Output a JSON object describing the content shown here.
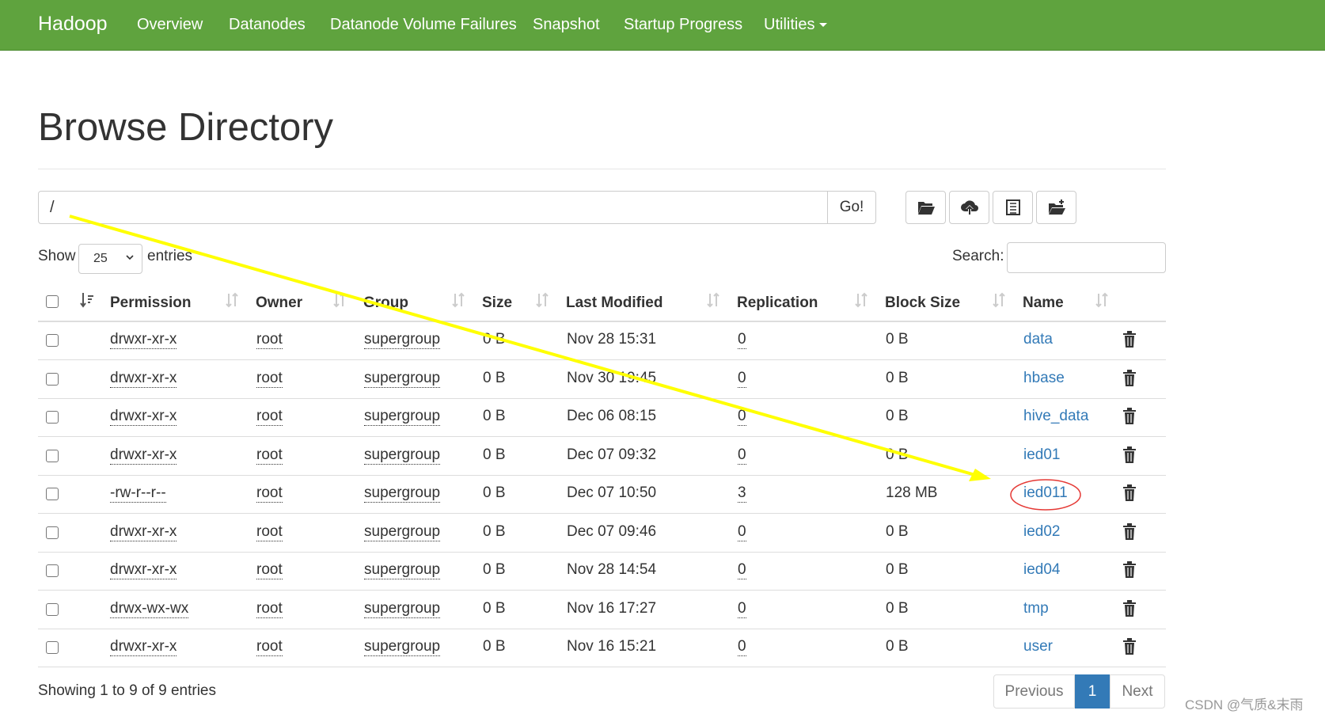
{
  "navbar": {
    "brand": "Hadoop",
    "items": [
      "Overview",
      "Datanodes",
      "Datanode Volume Failures",
      "Snapshot",
      "Startup Progress",
      "Utilities"
    ]
  },
  "page_title": "Browse Directory",
  "path_bar": {
    "value": "/",
    "go_label": "Go!"
  },
  "toolbar": {
    "icons": [
      "folder-open-icon",
      "cloud-upload-icon",
      "list-icon",
      "create-folder-icon"
    ]
  },
  "length": {
    "show_label": "Show",
    "selected": "25",
    "entries_label": "entries"
  },
  "search": {
    "label": "Search:",
    "value": ""
  },
  "table": {
    "columns": [
      "Permission",
      "Owner",
      "Group",
      "Size",
      "Last Modified",
      "Replication",
      "Block Size",
      "Name"
    ],
    "rows": [
      {
        "permission": "drwxr-xr-x",
        "owner": "root",
        "group": "supergroup",
        "size": "0 B",
        "modified": "Nov 28 15:31",
        "replication": "0",
        "block_size": "0 B",
        "name": "data"
      },
      {
        "permission": "drwxr-xr-x",
        "owner": "root",
        "group": "supergroup",
        "size": "0 B",
        "modified": "Nov 30 19:45",
        "replication": "0",
        "block_size": "0 B",
        "name": "hbase"
      },
      {
        "permission": "drwxr-xr-x",
        "owner": "root",
        "group": "supergroup",
        "size": "0 B",
        "modified": "Dec 06 08:15",
        "replication": "0",
        "block_size": "0 B",
        "name": "hive_data"
      },
      {
        "permission": "drwxr-xr-x",
        "owner": "root",
        "group": "supergroup",
        "size": "0 B",
        "modified": "Dec 07 09:32",
        "replication": "0",
        "block_size": "0 B",
        "name": "ied01"
      },
      {
        "permission": "-rw-r--r--",
        "owner": "root",
        "group": "supergroup",
        "size": "0 B",
        "modified": "Dec 07 10:50",
        "replication": "3",
        "block_size": "128 MB",
        "name": "ied011"
      },
      {
        "permission": "drwxr-xr-x",
        "owner": "root",
        "group": "supergroup",
        "size": "0 B",
        "modified": "Dec 07 09:46",
        "replication": "0",
        "block_size": "0 B",
        "name": "ied02"
      },
      {
        "permission": "drwxr-xr-x",
        "owner": "root",
        "group": "supergroup",
        "size": "0 B",
        "modified": "Nov 28 14:54",
        "replication": "0",
        "block_size": "0 B",
        "name": "ied04"
      },
      {
        "permission": "drwx-wx-wx",
        "owner": "root",
        "group": "supergroup",
        "size": "0 B",
        "modified": "Nov 16 17:27",
        "replication": "0",
        "block_size": "0 B",
        "name": "tmp"
      },
      {
        "permission": "drwxr-xr-x",
        "owner": "root",
        "group": "supergroup",
        "size": "0 B",
        "modified": "Nov 16 15:21",
        "replication": "0",
        "block_size": "0 B",
        "name": "user"
      }
    ]
  },
  "footer": {
    "info": "Showing 1 to 9 of 9 entries",
    "pagination": {
      "previous": "Previous",
      "current": "1",
      "next": "Next"
    }
  },
  "watermark": "CSDN @气质&末雨",
  "colors": {
    "navbar": "#5fa33e",
    "link": "#337ab7",
    "arrow": "#ffff00",
    "circle": "#e53935"
  }
}
